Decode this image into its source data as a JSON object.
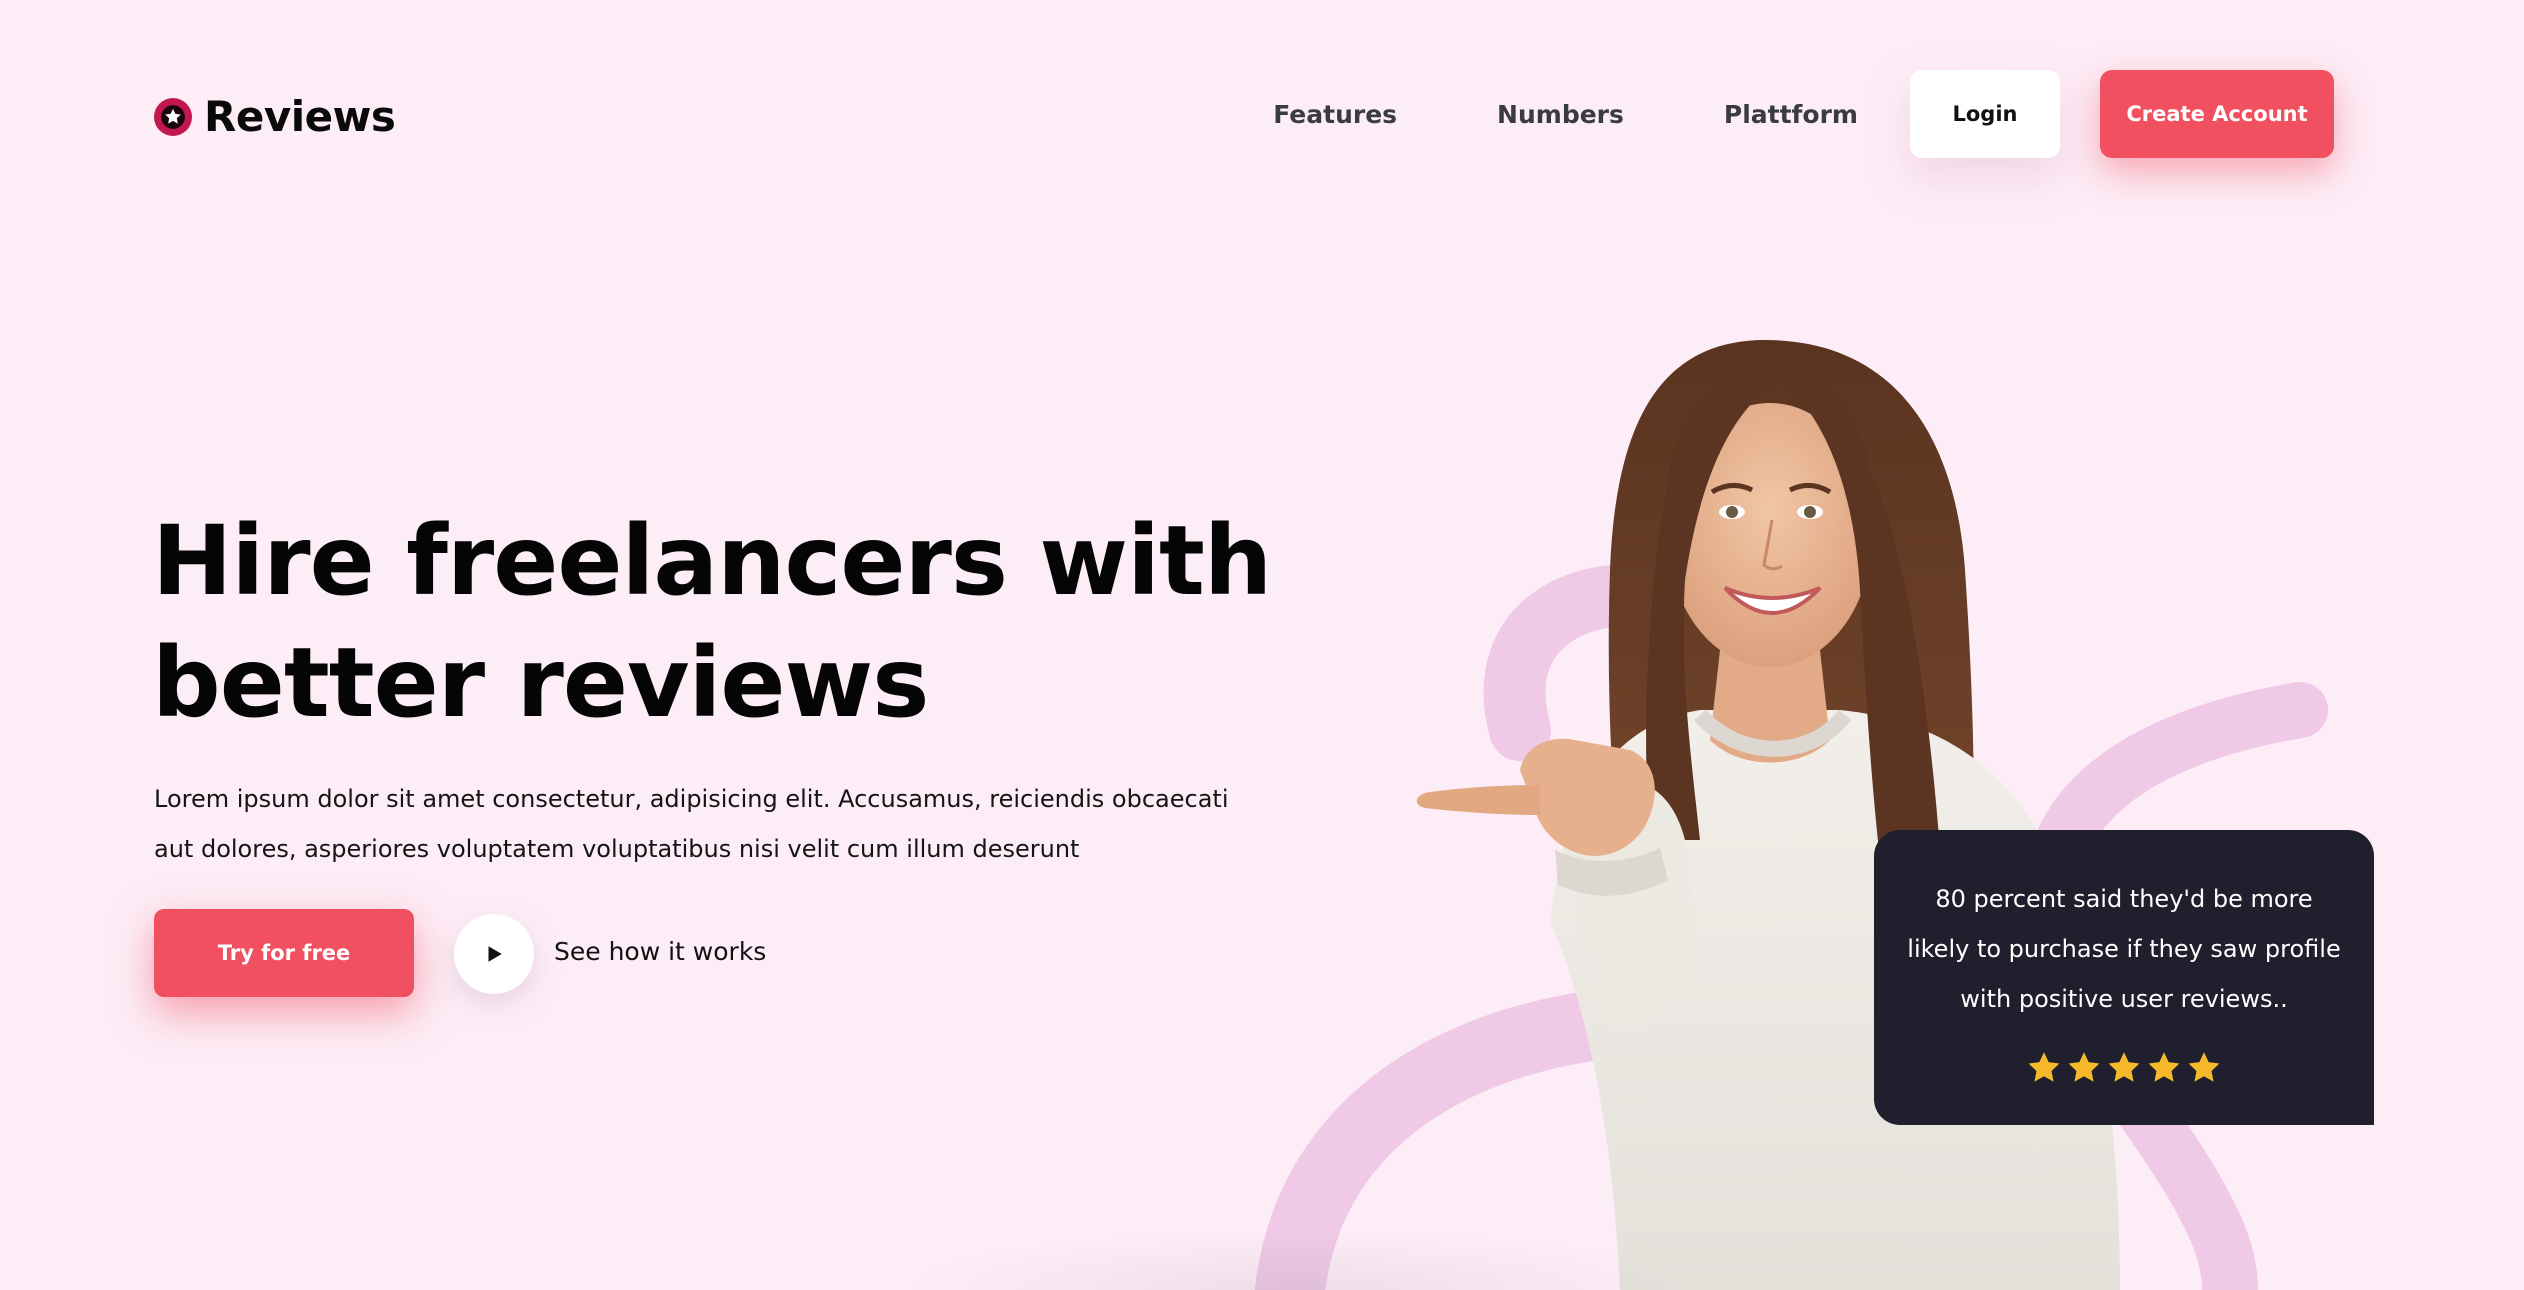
{
  "header": {
    "logo_text": "Reviews",
    "nav": [
      "Features",
      "Numbers",
      "Plattform"
    ],
    "login_label": "Login",
    "create_account_label": "Create Account"
  },
  "hero": {
    "title": "Hire freelancers with better reviews",
    "description": "Lorem ipsum dolor sit amet consectetur, adipisicing elit. Accusamus, reiciendis obcaecati aut dolores, asperiores voluptatem voluptatibus nisi velit cum illum deserunt",
    "primary_cta": "Try for free",
    "secondary_cta": "See how it works"
  },
  "review_card": {
    "text": "80 percent said they'd be more likely to purchase if they saw profile with positive user reviews..",
    "rating": 5,
    "max_rating": 5
  },
  "colors": {
    "background": "#fdedf6",
    "accent": "#f0505f",
    "card": "#1f1f2e",
    "star": "#f6b92b",
    "decoration": "#efc9e6"
  },
  "icons": {
    "logo": "star-badge-icon",
    "play": "play-icon",
    "rating": "star-icon"
  }
}
